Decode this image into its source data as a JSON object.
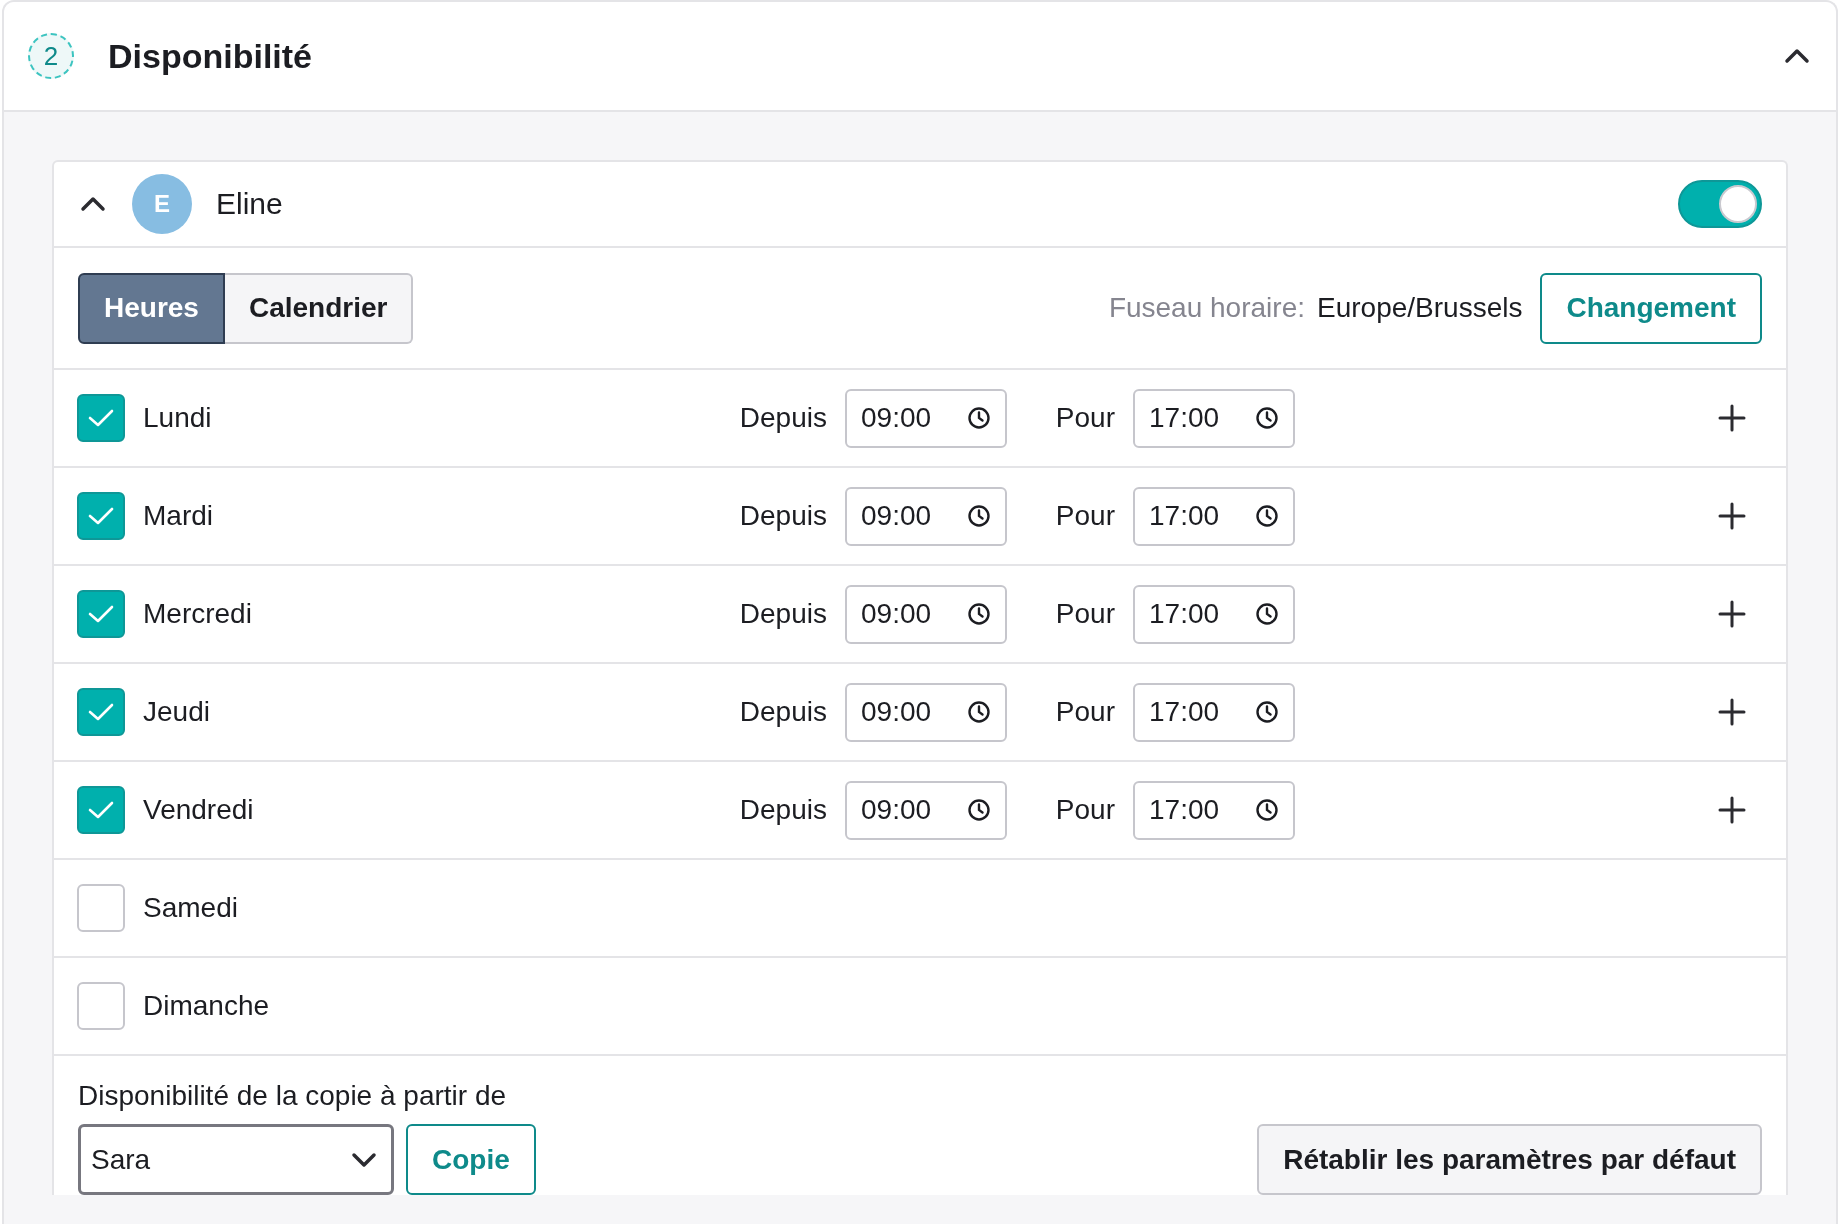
{
  "section": {
    "step": "2",
    "title": "Disponibilité",
    "expanded": true
  },
  "member": {
    "initial": "E",
    "name": "Eline",
    "expanded": true,
    "on": true
  },
  "tabs": [
    {
      "label": "Heures",
      "selected": true
    },
    {
      "label": "Calendrier",
      "selected": false
    }
  ],
  "timezone": {
    "label": "Fuseau horaire:",
    "value": "Europe/Brussels",
    "button": "Changement"
  },
  "days": [
    {
      "label": "Lundi",
      "checked": true,
      "from_label": "Depuis",
      "from": "09:00",
      "to_label": "Pour",
      "to": "17:00"
    },
    {
      "label": "Mardi",
      "checked": true,
      "from_label": "Depuis",
      "from": "09:00",
      "to_label": "Pour",
      "to": "17:00"
    },
    {
      "label": "Mercredi",
      "checked": true,
      "from_label": "Depuis",
      "from": "09:00",
      "to_label": "Pour",
      "to": "17:00"
    },
    {
      "label": "Jeudi",
      "checked": true,
      "from_label": "Depuis",
      "from": "09:00",
      "to_label": "Pour",
      "to": "17:00"
    },
    {
      "label": "Vendredi",
      "checked": true,
      "from_label": "Depuis",
      "from": "09:00",
      "to_label": "Pour",
      "to": "17:00"
    },
    {
      "label": "Samedi",
      "checked": false
    },
    {
      "label": "Dimanche",
      "checked": false
    }
  ],
  "copy": {
    "label": "Disponibilité de la copie à partir de",
    "value": "Sara",
    "button": "Copie"
  },
  "reset_button": "Rétablir les paramètres par défaut"
}
